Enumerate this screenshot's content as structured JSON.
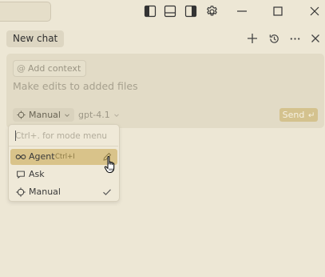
{
  "chat": {
    "tab_label": "New chat"
  },
  "composer": {
    "add_context_label": "Add context",
    "placeholder": "Make edits to added files",
    "mode_label": "Manual",
    "model_label": "gpt-4.1",
    "send_label": "Send"
  },
  "mode_menu": {
    "search_placeholder": "Ctrl+. for mode menu",
    "items": [
      {
        "label": "Agent",
        "shortcut": "Ctrl+I",
        "icon": "infinity-icon",
        "active": true
      },
      {
        "label": "Ask",
        "shortcut": "",
        "icon": "chat-bubble-icon",
        "active": false
      },
      {
        "label": "Manual",
        "shortcut": "",
        "icon": "crosshair-icon",
        "active": false,
        "checked": true
      }
    ]
  },
  "colors": {
    "background": "#ede7d5",
    "composer": "#e2dbc6",
    "accent": "#d9c38a",
    "send": "#d4c28e"
  }
}
